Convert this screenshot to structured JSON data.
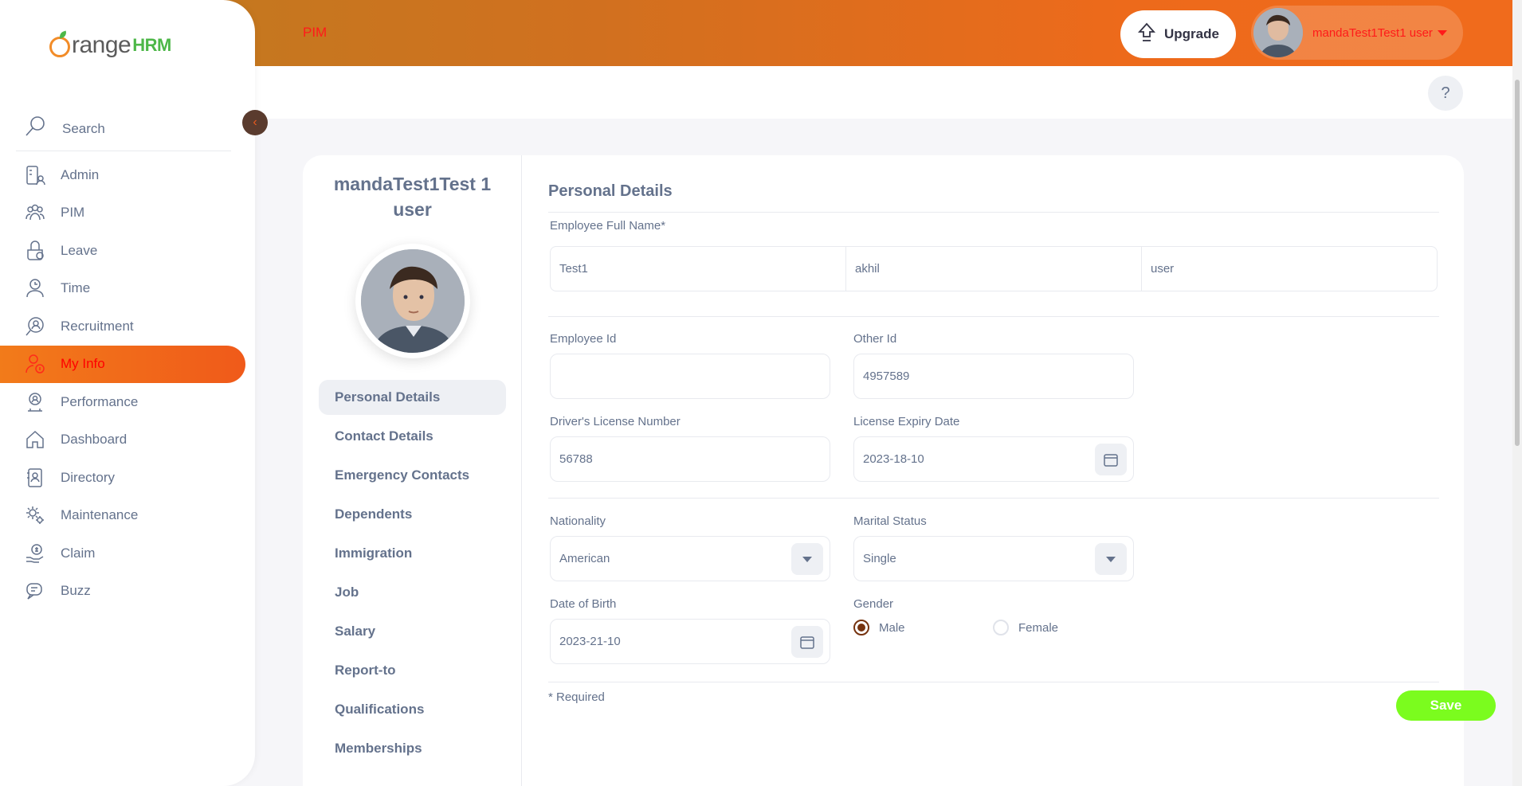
{
  "brand": {
    "o": "O",
    "range": "range",
    "hrm": "HRM"
  },
  "sidebar": {
    "search_label": "Search",
    "collapse_glyph": "‹",
    "items": [
      {
        "label": "Admin",
        "icon": "admin-icon"
      },
      {
        "label": "PIM",
        "icon": "pim-icon"
      },
      {
        "label": "Leave",
        "icon": "leave-icon"
      },
      {
        "label": "Time",
        "icon": "time-icon"
      },
      {
        "label": "Recruitment",
        "icon": "recruitment-icon"
      },
      {
        "label": "My Info",
        "icon": "my-info-icon",
        "active": true
      },
      {
        "label": "Performance",
        "icon": "performance-icon"
      },
      {
        "label": "Dashboard",
        "icon": "dashboard-icon"
      },
      {
        "label": "Directory",
        "icon": "directory-icon"
      },
      {
        "label": "Maintenance",
        "icon": "maintenance-icon"
      },
      {
        "label": "Claim",
        "icon": "claim-icon"
      },
      {
        "label": "Buzz",
        "icon": "buzz-icon"
      }
    ]
  },
  "header": {
    "module": "PIM",
    "upgrade_label": "Upgrade",
    "user_name": "mandaTest1Test1 user",
    "help_glyph": "?"
  },
  "profile": {
    "name": "mandaTest1Test 1 user",
    "tabs": [
      "Personal Details",
      "Contact Details",
      "Emergency Contacts",
      "Dependents",
      "Immigration",
      "Job",
      "Salary",
      "Report-to",
      "Qualifications",
      "Memberships"
    ],
    "active_tab": "Personal Details"
  },
  "form": {
    "title": "Personal Details",
    "full_name_label": "Employee Full Name*",
    "first_name": "Test1",
    "middle_name": "akhil",
    "last_name": "user",
    "employee_id_label": "Employee Id",
    "employee_id": "",
    "other_id_label": "Other Id",
    "other_id": "4957589",
    "license_label": "Driver's License Number",
    "license": "56788",
    "license_expiry_label": "License Expiry Date",
    "license_expiry": "2023-18-10",
    "nationality_label": "Nationality",
    "nationality": "American",
    "marital_label": "Marital Status",
    "marital": "Single",
    "dob_label": "Date of Birth",
    "dob": "2023-21-10",
    "gender_label": "Gender",
    "gender_options": [
      "Male",
      "Female"
    ],
    "gender_selected": "Male",
    "required_note": "* Required",
    "save_label": "Save"
  },
  "colors": {
    "accent": "#f05a1a",
    "save": "#7bfc1e",
    "active_text": "#ff0000"
  }
}
